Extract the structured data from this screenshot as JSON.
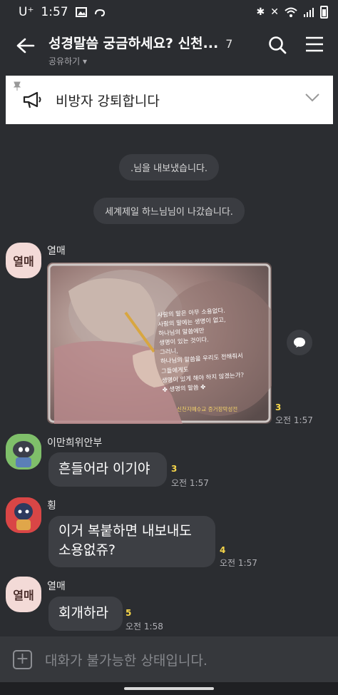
{
  "status": {
    "carrier": "U⁺",
    "time": "1:57"
  },
  "header": {
    "title": "성경말씀 궁금하세요? 신천...",
    "member_count": "7",
    "subtitle": "공유하기 ▾"
  },
  "notice": {
    "text": "비방자 강퇴합니다"
  },
  "system_messages": [
    ".님을 내보냈습니다.",
    "세계제일 하느님님이 나갔습니다."
  ],
  "messages": [
    {
      "sender": "열매",
      "avatar_text": "열매",
      "unread": "3",
      "time": "오전 1:57",
      "image_text": [
        "사람의 말은 아무 소용없다.",
        "사람의 말에는 생명이 없고,",
        "하나님의 말씀에만",
        "생명이 있는 것이다.",
        "그러니,",
        "하나님의 말씀을 우리도 전해줘서",
        "그들에게도",
        "생명이 있게 해야 하지 않겠는가?",
        "✤ 생명의 말씀 ✤"
      ],
      "image_signature": "신천지예수교 증거장막성전"
    },
    {
      "sender": "이만희위안부",
      "text": "흔들어라 이기야",
      "unread": "3",
      "time": "오전 1:57"
    },
    {
      "sender": "횡",
      "text_line1": "이거 복붙하면 내보내도",
      "text_line2": "소용없쥬?",
      "unread": "4",
      "time": "오전 1:57"
    },
    {
      "sender": "열매",
      "avatar_text": "열매",
      "text": "회개하라",
      "unread": "5",
      "time": "오전 1:58"
    }
  ],
  "input": {
    "placeholder": "대화가 불가능한 상태입니다."
  },
  "colors": {
    "background": "#2b2d31",
    "bubble": "#3d3f44",
    "unread": "#f7d64a",
    "notice": "#ffffff"
  }
}
